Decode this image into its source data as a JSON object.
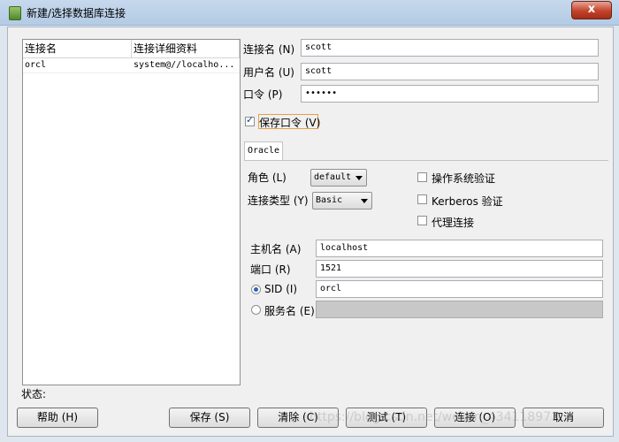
{
  "window": {
    "title": "新建/选择数据库连接",
    "close_label": "x"
  },
  "list": {
    "headers": [
      "连接名",
      "连接详细资料"
    ],
    "rows": [
      {
        "name": "orcl",
        "details": "system@//localho..."
      }
    ]
  },
  "form": {
    "conn_name_label": "连接名 (N)",
    "conn_name_value": "scott",
    "user_label": "用户名 (U)",
    "user_value": "scott",
    "password_label": "口令 (P)",
    "password_value": "••••••",
    "save_password_label": "保存口令 (V)",
    "save_password_checked": true
  },
  "tab": {
    "label": "Oracle"
  },
  "oracle": {
    "role_label": "角色 (L)",
    "role_value": "default",
    "conn_type_label": "连接类型 (Y)",
    "conn_type_value": "Basic",
    "os_auth_label": "操作系统验证",
    "kerberos_label": "Kerberos 验证",
    "proxy_label": "代理连接",
    "host_label": "主机名 (A)",
    "host_value": "localhost",
    "port_label": "端口 (R)",
    "port_value": "1521",
    "sid_label": "SID (I)",
    "sid_value": "orcl",
    "service_label": "服务名 (E)",
    "service_value": ""
  },
  "status": {
    "label": "状态:"
  },
  "buttons": {
    "help": "帮助 (H)",
    "save": "保存 (S)",
    "clear": "清除 (C)",
    "test": "测试 (T)",
    "connect": "连接 (O)",
    "cancel": "取消"
  },
  "watermark": "https://blog.csdn.net/weixin_43411897"
}
